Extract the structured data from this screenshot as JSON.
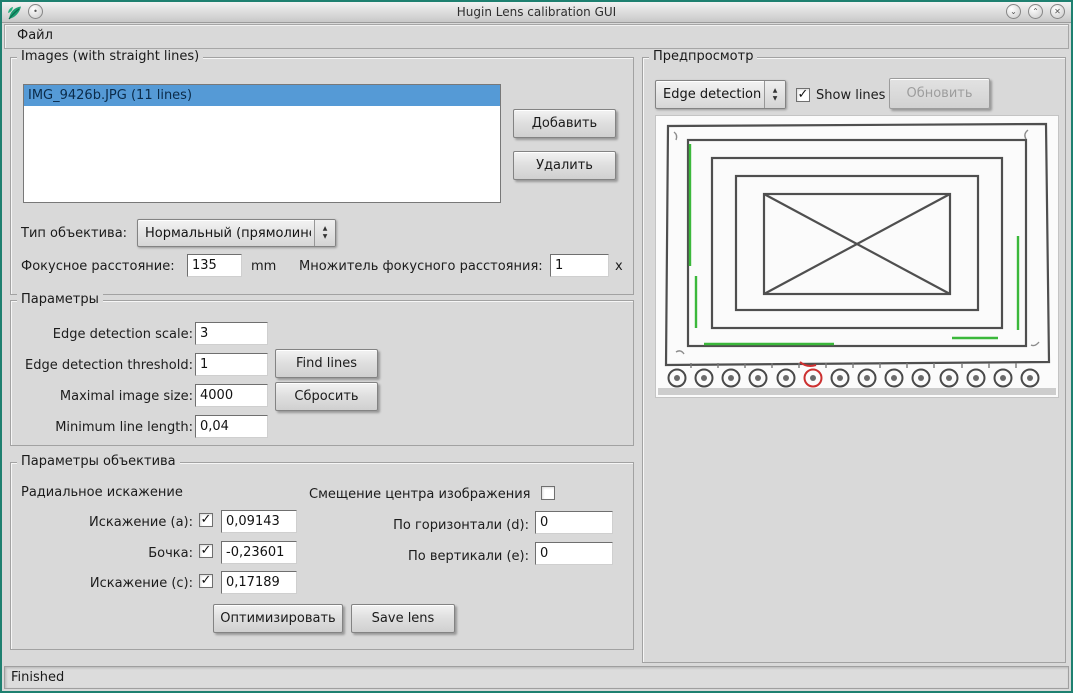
{
  "window": {
    "title": "Hugin Lens calibration GUI"
  },
  "icons": {
    "window_menu": "•",
    "minimize": "⌄",
    "maximize": "⌃",
    "close": "✕",
    "spinner_up": "▲",
    "spinner_down": "▼",
    "check": "✓"
  },
  "menu": {
    "file_label": "Файл"
  },
  "images_group": {
    "title": "Images (with straight lines)",
    "list": [
      {
        "label": "IMG_9426b.JPG (11 lines)",
        "selected": true
      }
    ],
    "add_button": "Добавить",
    "remove_button": "Удалить",
    "lens_type_label": "Тип объектива:",
    "lens_type_value": "Нормальный (прямолине",
    "focal_label": "Фокусное расстояние:",
    "focal_value": "135",
    "focal_unit": "mm",
    "crop_label": "Множитель фокусного расстояния:",
    "crop_value": "1",
    "crop_unit": "x"
  },
  "parameters_group": {
    "title": "Параметры",
    "rows": [
      {
        "label": "Edge detection scale:",
        "value": "3"
      },
      {
        "label": "Edge detection threshold:",
        "value": "1"
      },
      {
        "label": "Maximal image size:",
        "value": "4000"
      },
      {
        "label": "Minimum line length:",
        "value": "0,04"
      }
    ],
    "find_lines_button": "Find lines",
    "reset_button": "Сбросить"
  },
  "lens_group": {
    "title": "Параметры объектива",
    "radial_heading": "Радиальное искажение",
    "center_heading": "Смещение центра изображения",
    "a_label": "Искажение (a):",
    "a_value": "0,09143",
    "b_label": "Бочка:",
    "b_value": "-0,23601",
    "c_label": "Искажение (c):",
    "c_value": "0,17189",
    "d_label": "По горизонтали (d):",
    "d_value": "0",
    "e_label": "По вертикали (e):",
    "e_value": "0",
    "optimize_button": "Оптимизировать",
    "save_lens_button": "Save lens"
  },
  "preview_group": {
    "title": "Предпросмотр",
    "mode_value": "Edge detection",
    "show_lines_label": "Show lines",
    "refresh_button": "Обновить"
  },
  "statusbar": {
    "text": "Finished"
  }
}
